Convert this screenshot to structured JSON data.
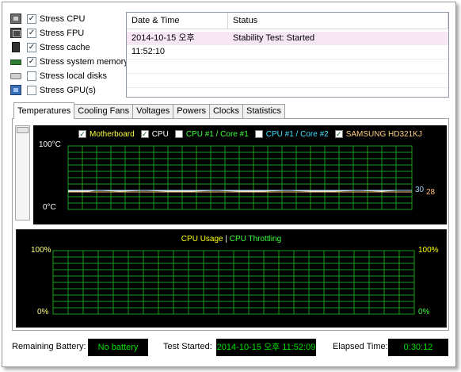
{
  "stress_options": [
    {
      "label": "Stress CPU",
      "checked": true,
      "icon": "cpu-icon"
    },
    {
      "label": "Stress FPU",
      "checked": true,
      "icon": "fpu-icon"
    },
    {
      "label": "Stress cache",
      "checked": true,
      "icon": "cache-icon"
    },
    {
      "label": "Stress system memory",
      "checked": true,
      "icon": "memory-icon"
    },
    {
      "label": "Stress local disks",
      "checked": false,
      "icon": "disk-icon"
    },
    {
      "label": "Stress GPU(s)",
      "checked": false,
      "icon": "gpu-icon"
    }
  ],
  "log": {
    "headers": [
      "Date & Time",
      "Status"
    ],
    "rows": [
      {
        "datetime": "2014-10-15 오후 11:52:10",
        "status": "Stability Test: Started"
      }
    ]
  },
  "tabs": [
    "Temperatures",
    "Cooling Fans",
    "Voltages",
    "Powers",
    "Clocks",
    "Statistics"
  ],
  "active_tab": "Temperatures",
  "temp_graph": {
    "legend": [
      {
        "label": "Motherboard",
        "checked": true,
        "color": "#ffff40"
      },
      {
        "label": "CPU",
        "checked": true,
        "color": "#ffffff"
      },
      {
        "label": "CPU #1 / Core #1",
        "checked": false,
        "color": "#40ff40"
      },
      {
        "label": "CPU #1 / Core #2",
        "checked": false,
        "color": "#40e0ff"
      },
      {
        "label": "SAMSUNG HD321KJ",
        "checked": true,
        "color": "#ffd080"
      }
    ],
    "y_max_label": "100°C",
    "y_min_label": "0°C",
    "current_values": [
      {
        "value": "30",
        "color": "#9fd4ff"
      },
      {
        "value": "28",
        "color": "#ffc070"
      }
    ],
    "grid_color": "#1a9e1a"
  },
  "cpu_graph": {
    "legend": [
      {
        "label": "CPU Usage",
        "color": "#ffff00"
      },
      {
        "label": "|",
        "color": "#ffffff"
      },
      {
        "label": "CPU Throttling",
        "color": "#40ff40"
      }
    ],
    "y_left_max": "100%",
    "y_left_min": "0%",
    "y_right_max": "100%",
    "y_right_min": "0%",
    "grid_color": "#1a9e1a"
  },
  "status_bar": {
    "battery_label": "Remaining Battery:",
    "battery_value": "No battery",
    "test_started_label": "Test Started:",
    "test_started_value": "2014-10-15 오후 11:52:09",
    "elapsed_label": "Elapsed Time:",
    "elapsed_value": "0:30:12"
  }
}
